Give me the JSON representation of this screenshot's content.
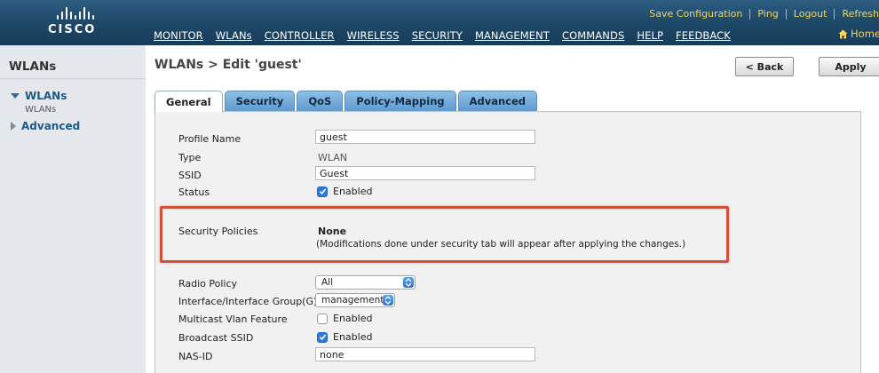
{
  "header": {
    "logo_text": "CISCO",
    "utility_links": [
      "Save Configuration",
      "Ping",
      "Logout",
      "Refresh"
    ],
    "nav": [
      "MONITOR",
      "WLANs",
      "CONTROLLER",
      "WIRELESS",
      "SECURITY",
      "MANAGEMENT",
      "COMMANDS",
      "HELP",
      "FEEDBACK"
    ],
    "home_label": "Home",
    "home_icon": "home-icon",
    "accent_color": "#f6d55b",
    "bar_color": "#1f4a6a"
  },
  "sidebar": {
    "title": "WLANs",
    "sections": [
      {
        "label": "WLANs",
        "expanded": true,
        "children": [
          "WLANs"
        ]
      },
      {
        "label": "Advanced",
        "expanded": false,
        "children": []
      }
    ]
  },
  "page": {
    "title": "WLANs > Edit  'guest'",
    "back_button": "< Back",
    "apply_button": "Apply"
  },
  "tabs": [
    {
      "label": "General",
      "active": true
    },
    {
      "label": "Security",
      "active": false
    },
    {
      "label": "QoS",
      "active": false
    },
    {
      "label": "Policy-Mapping",
      "active": false
    },
    {
      "label": "Advanced",
      "active": false
    }
  ],
  "form": {
    "profile_name": {
      "label": "Profile Name",
      "value": "guest"
    },
    "type": {
      "label": "Type",
      "value": "WLAN"
    },
    "ssid": {
      "label": "SSID",
      "value": "Guest"
    },
    "status": {
      "label": "Status",
      "checked": true,
      "text": "Enabled"
    },
    "security_policies": {
      "label": "Security Policies",
      "value": "None",
      "note": "(Modifications done under security tab will appear after applying the changes.)"
    },
    "radio_policy": {
      "label": "Radio Policy",
      "selected": "All"
    },
    "interface": {
      "label": "Interface/Interface Group(G)",
      "selected": "management"
    },
    "multicast_vlan": {
      "label": "Multicast Vlan Feature",
      "checked": false,
      "text": "Enabled"
    },
    "broadcast_ssid": {
      "label": "Broadcast SSID",
      "checked": true,
      "text": "Enabled"
    },
    "nas_id": {
      "label": "NAS-ID",
      "value": "none"
    }
  }
}
